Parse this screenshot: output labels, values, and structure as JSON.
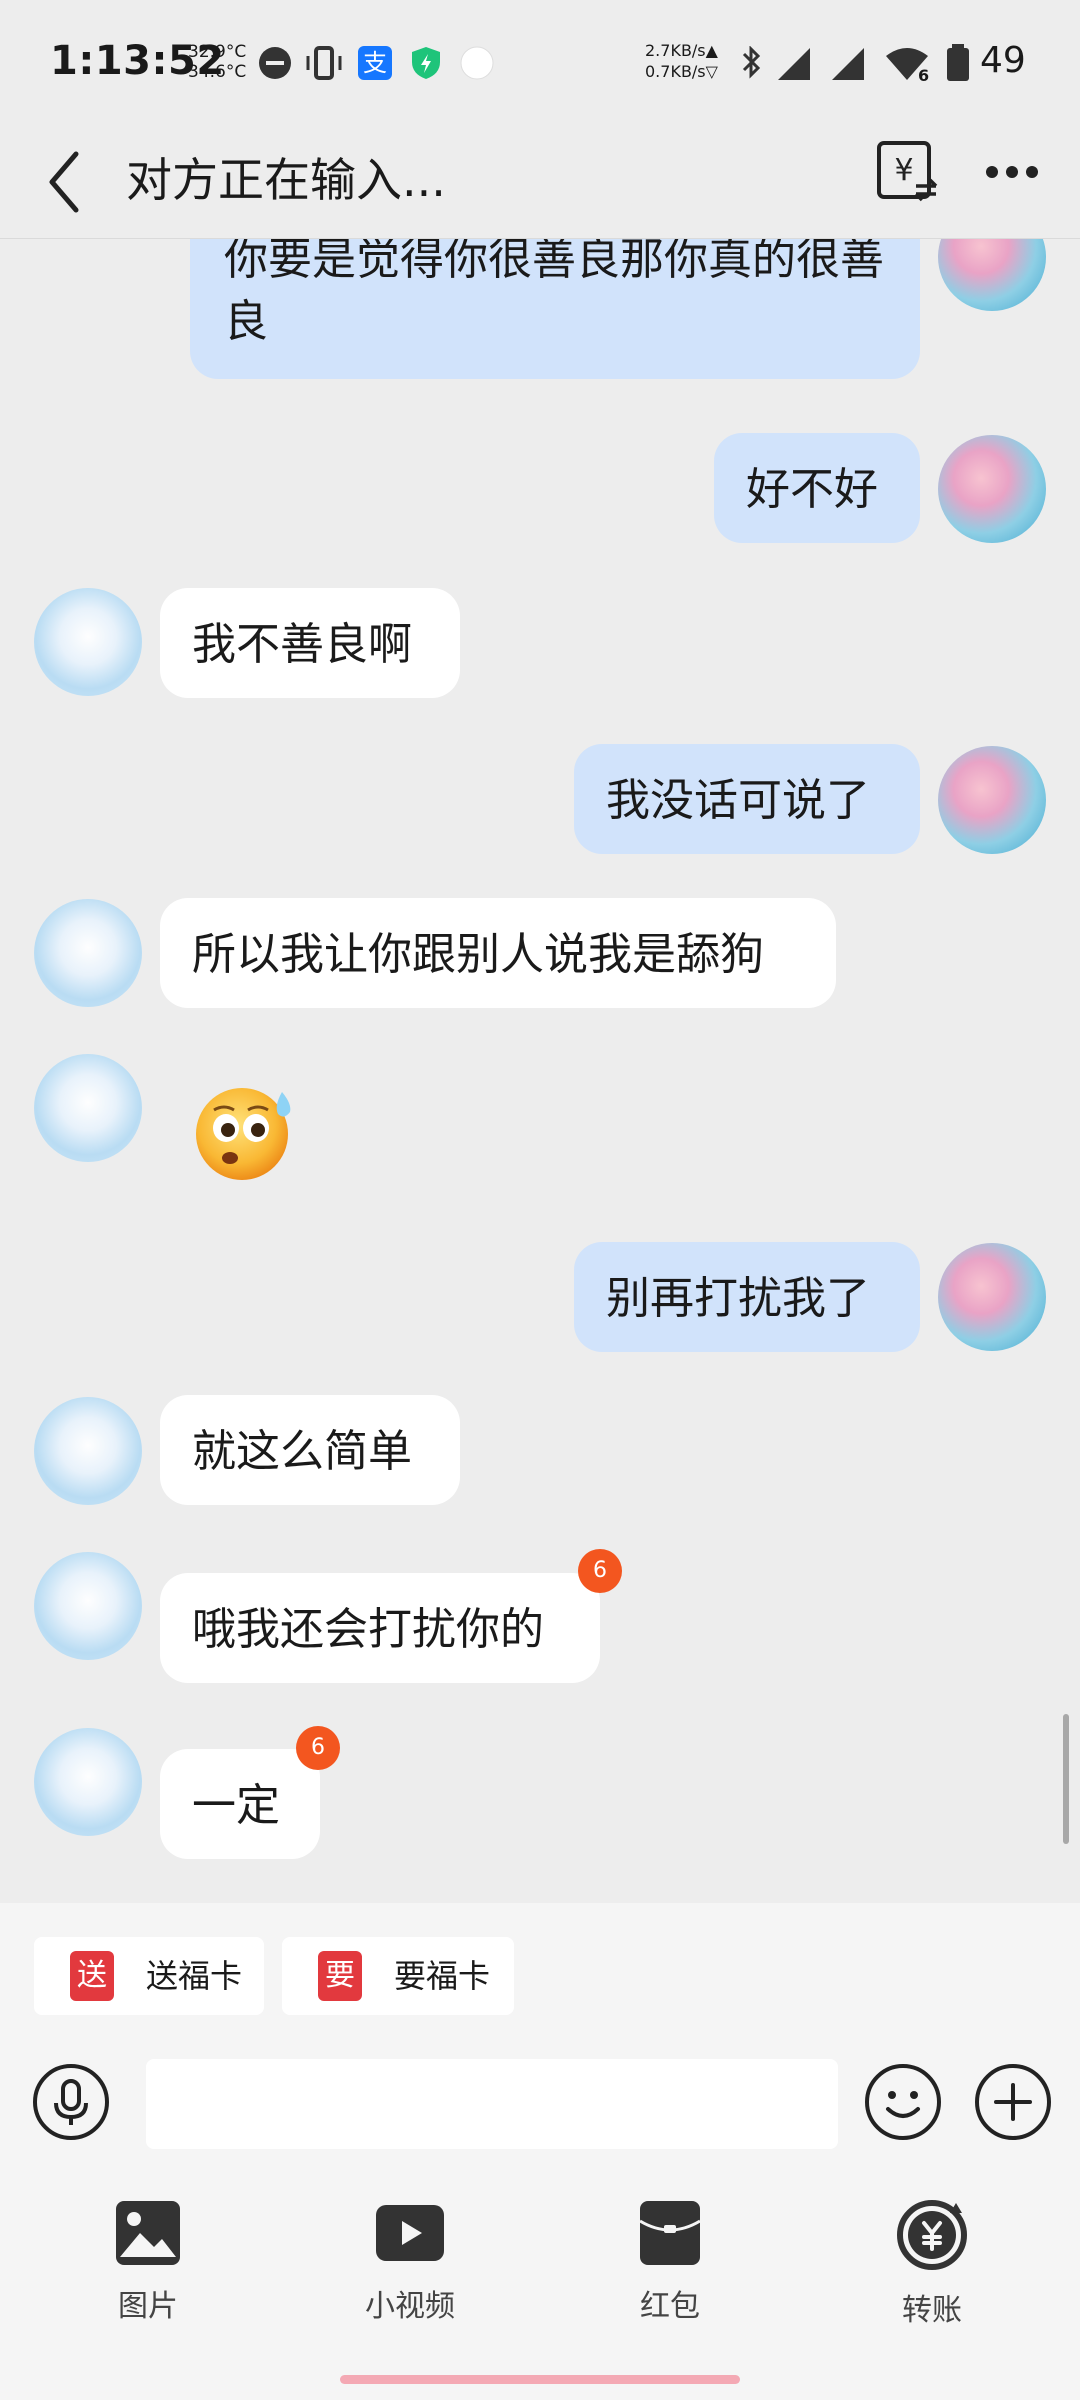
{
  "status_bar": {
    "time": "1:13:52",
    "temp_1": "32.9°C",
    "temp_2": "34.6°C",
    "net_up": "2.7KB/s▲",
    "net_down": "0.7KB/s▽",
    "battery": "49",
    "alipay_glyph": "支",
    "signal_label": "6"
  },
  "header": {
    "title": "对方正在输入...",
    "money_glyph": "¥"
  },
  "messages": [
    {
      "from": "me",
      "text": "你要是觉得你很善良那你真的很善良"
    },
    {
      "from": "me",
      "text": "好不好"
    },
    {
      "from": "other",
      "text": "我不善良啊"
    },
    {
      "from": "me",
      "text": "我没话可说了"
    },
    {
      "from": "other",
      "text": "所以我让你跟别人说我是舔狗"
    },
    {
      "from": "other",
      "type": "emoji",
      "icon": "flushed-sweat-emoji"
    },
    {
      "from": "me",
      "text": "别再打扰我了"
    },
    {
      "from": "other",
      "text": "就这么简单"
    },
    {
      "from": "other",
      "text": "哦我还会打扰你的",
      "badge": "6"
    },
    {
      "from": "other",
      "text": "一定",
      "badge": "6"
    }
  ],
  "quick_cards": [
    {
      "icon_glyph": "送",
      "label": "送福卡"
    },
    {
      "icon_glyph": "要",
      "label": "要福卡"
    }
  ],
  "input": {
    "value": "",
    "placeholder": ""
  },
  "tools": [
    {
      "label": "图片",
      "icon": "image-icon"
    },
    {
      "label": "小视频",
      "icon": "video-icon"
    },
    {
      "label": "红包",
      "icon": "red-packet-icon"
    },
    {
      "label": "转账",
      "icon": "transfer-icon"
    }
  ],
  "colors": {
    "background": "#EDEDED",
    "my_bubble": "#D1E3FB",
    "other_bubble": "#FFFFFF",
    "badge": "#F3561F",
    "card_icon": "#E2393E"
  }
}
